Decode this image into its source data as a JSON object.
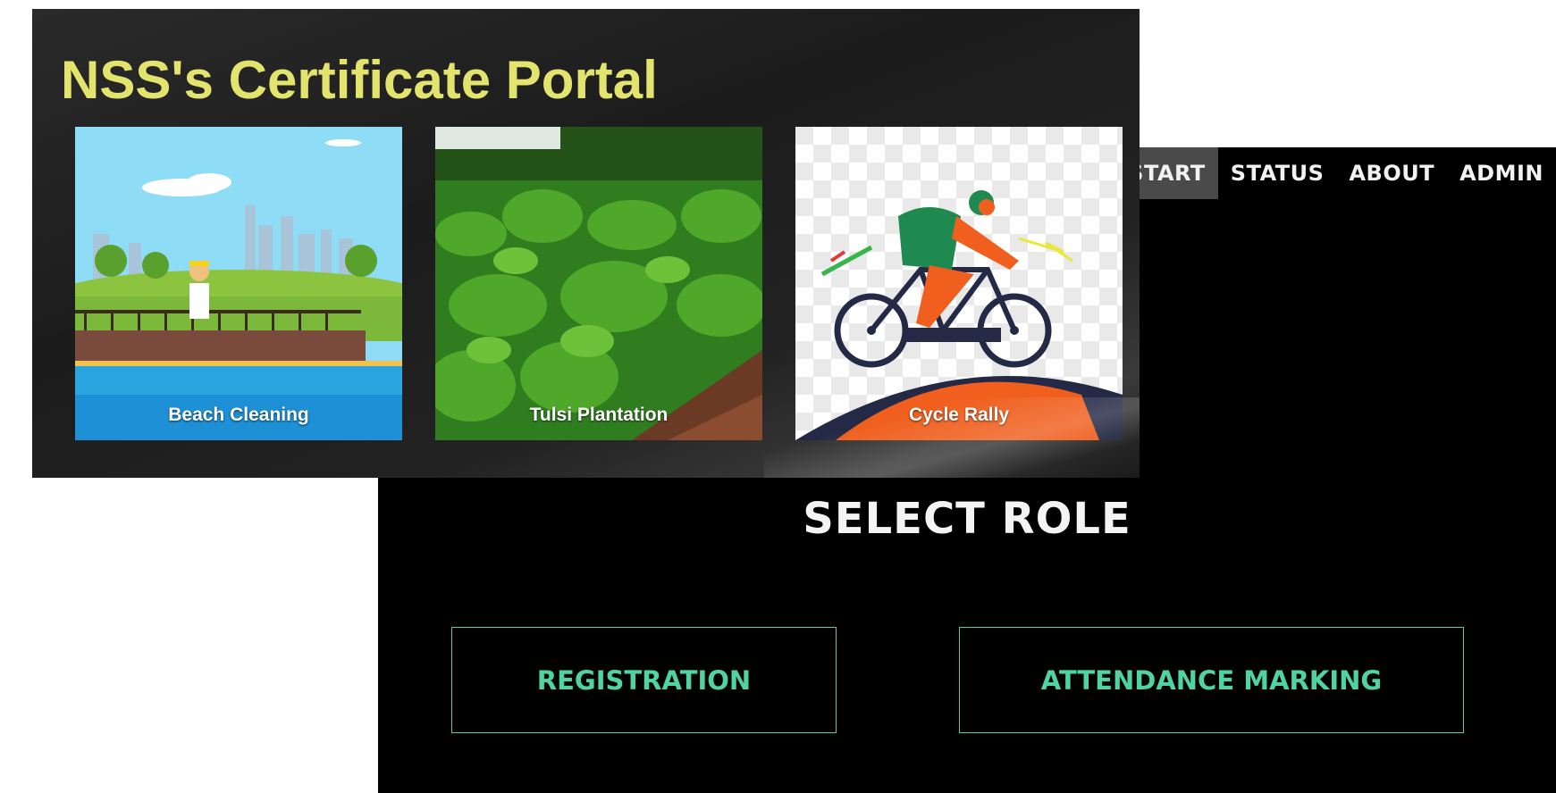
{
  "nav": {
    "items": [
      {
        "label": "START",
        "active": true
      },
      {
        "label": "STATUS",
        "active": false
      },
      {
        "label": "ABOUT",
        "active": false
      },
      {
        "label": "ADMIN",
        "active": false
      }
    ]
  },
  "banner": {
    "title": "NSS's Certificate Portal",
    "cards": [
      {
        "label": "Beach Cleaning",
        "image": "beach-cleaning-illustration"
      },
      {
        "label": "Tulsi Plantation",
        "image": "tulsi-plantation-photo"
      },
      {
        "label": "Cycle Rally",
        "image": "cycle-rally-illustration"
      }
    ]
  },
  "roles": {
    "title": "SELECT ROLE",
    "registration_label": "REGISTRATION",
    "attendance_label": "ATTENDANCE MARKING"
  },
  "colors": {
    "title_yellow": "#e3e46e",
    "accent_green": "#4fd3a0",
    "nav_active_bg": "#4a4a4a",
    "background": "#000000"
  }
}
